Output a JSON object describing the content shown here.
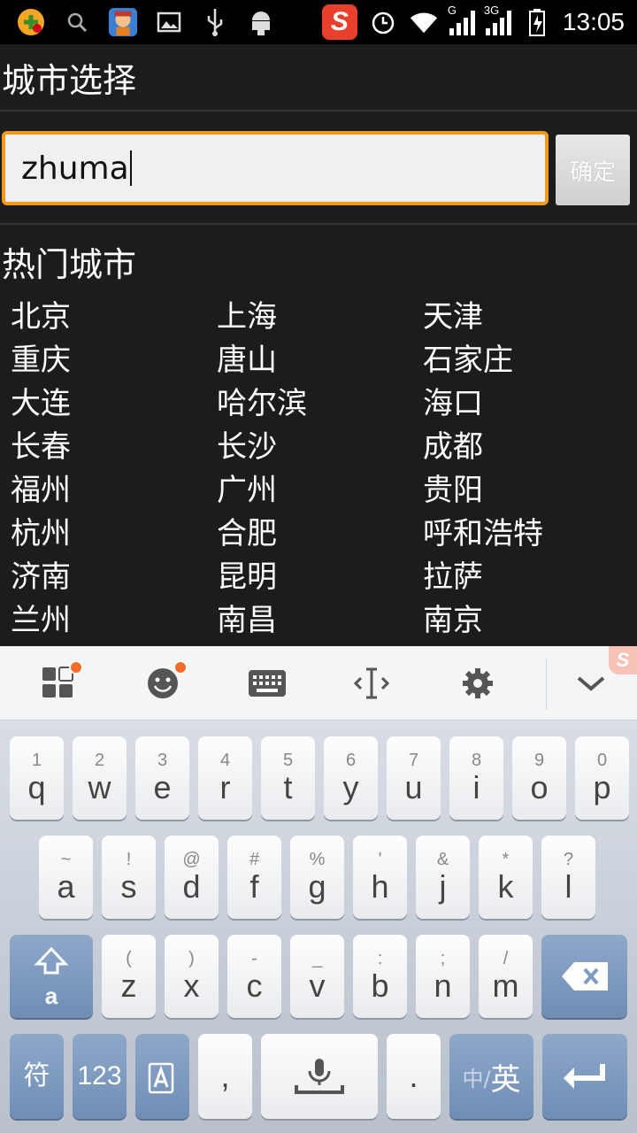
{
  "status_bar": {
    "time": "13:05",
    "network_g": "G",
    "network_3g": "3G",
    "app_badge": "S",
    "icons": [
      "game-icon",
      "search-icon",
      "avatar-app-icon",
      "image-icon",
      "usb-icon",
      "android-icon",
      "sogou-icon",
      "alarm-icon",
      "wifi-icon",
      "signal-icon",
      "signal-3g-icon",
      "battery-icon"
    ]
  },
  "header": {
    "title": "城市选择"
  },
  "search": {
    "value": "zhuma",
    "confirm_label": "确定"
  },
  "hot": {
    "title": "热门城市",
    "rows": [
      [
        "北京",
        "上海",
        "天津"
      ],
      [
        "重庆",
        "唐山",
        "石家庄"
      ],
      [
        "大连",
        "哈尔滨",
        "海口"
      ],
      [
        "长春",
        "长沙",
        "成都"
      ],
      [
        "福州",
        "广州",
        "贵阳"
      ],
      [
        "杭州",
        "合肥",
        "呼和浩特"
      ],
      [
        "济南",
        "昆明",
        "拉萨"
      ],
      [
        "兰州",
        "南昌",
        "南京"
      ]
    ]
  },
  "keyboard": {
    "toolbar_icons": [
      "menu-grid-icon",
      "emoji-icon",
      "keyboard-icon",
      "cursor-icon",
      "settings-icon",
      "collapse-icon"
    ],
    "corner_badge": "S",
    "row1": [
      {
        "sub": "1",
        "main": "q"
      },
      {
        "sub": "2",
        "main": "w"
      },
      {
        "sub": "3",
        "main": "e"
      },
      {
        "sub": "4",
        "main": "r"
      },
      {
        "sub": "5",
        "main": "t"
      },
      {
        "sub": "6",
        "main": "y"
      },
      {
        "sub": "7",
        "main": "u"
      },
      {
        "sub": "8",
        "main": "i"
      },
      {
        "sub": "9",
        "main": "o"
      },
      {
        "sub": "0",
        "main": "p"
      }
    ],
    "row2": [
      {
        "sub": "~",
        "main": "a"
      },
      {
        "sub": "!",
        "main": "s"
      },
      {
        "sub": "@",
        "main": "d"
      },
      {
        "sub": "#",
        "main": "f"
      },
      {
        "sub": "%",
        "main": "g"
      },
      {
        "sub": "'",
        "main": "h"
      },
      {
        "sub": "&",
        "main": "j"
      },
      {
        "sub": "*",
        "main": "k"
      },
      {
        "sub": "?",
        "main": "l"
      }
    ],
    "row3": [
      {
        "sub": "(",
        "main": "z"
      },
      {
        "sub": ")",
        "main": "x"
      },
      {
        "sub": "-",
        "main": "c"
      },
      {
        "sub": "_",
        "main": "v"
      },
      {
        "sub": ":",
        "main": "b"
      },
      {
        "sub": ";",
        "main": "n"
      },
      {
        "sub": "/",
        "main": "m"
      }
    ],
    "shift_sub": "a",
    "symbols_label": "符",
    "numbers_label": "123",
    "comma_label": ",",
    "period_label": ".",
    "lang_label_zh": "中/",
    "lang_label_en": "英"
  }
}
